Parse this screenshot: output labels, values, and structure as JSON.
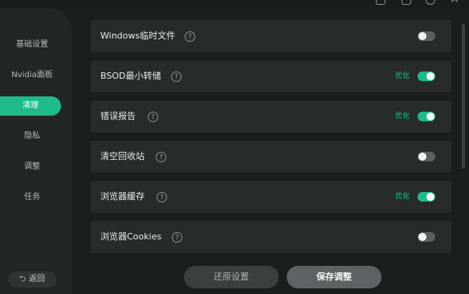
{
  "sidebar": {
    "items": [
      {
        "label": "基础设置"
      },
      {
        "label": "Nvidia面板"
      },
      {
        "label": "清理",
        "active": true
      },
      {
        "label": "隐私"
      },
      {
        "label": "调整"
      },
      {
        "label": "任务"
      }
    ],
    "back_label": "返回"
  },
  "rows": [
    {
      "label": "Windows临时文件",
      "status": "",
      "toggle": "off"
    },
    {
      "label": "BSOD最小转储",
      "status": "优化",
      "toggle": "on"
    },
    {
      "label": "错误报告",
      "status": "优化",
      "toggle": "on"
    },
    {
      "label": "清空回收站",
      "status": "",
      "toggle": "off"
    },
    {
      "label": "浏览器缓存",
      "status": "优化",
      "toggle": "on"
    },
    {
      "label": "浏览器Cookies",
      "status": "",
      "toggle": "off"
    }
  ],
  "help_glyph": "?",
  "actions": {
    "restore_label": "还原设置",
    "save_label": "保存调整"
  },
  "colors": {
    "accent": "#1fb98a",
    "row_bg": "#272b2c",
    "sidebar_bg": "#222627",
    "app_bg": "#1b1e1f"
  }
}
